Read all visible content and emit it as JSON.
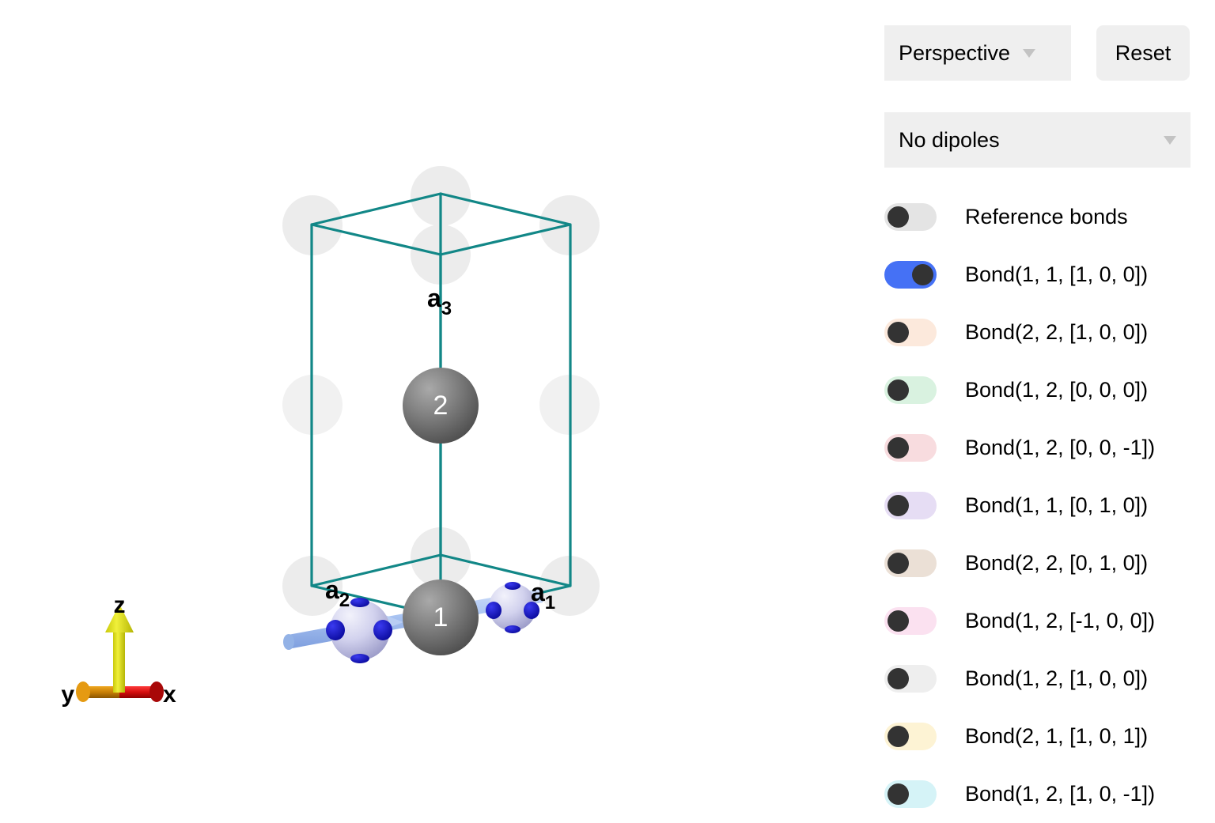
{
  "controls": {
    "projection": {
      "value": "Perspective",
      "caret_icon": "chevron-down-icon"
    },
    "reset": {
      "label": "Reset"
    },
    "dipoles": {
      "value": "No dipoles",
      "caret_icon": "chevron-down-icon"
    }
  },
  "legend": {
    "items": [
      {
        "label": "Reference bonds",
        "on": false,
        "color": "#e4e4e4"
      },
      {
        "label": "Bond(1, 1, [1, 0, 0])",
        "on": true,
        "color": "#4571f5"
      },
      {
        "label": "Bond(2, 2, [1, 0, 0])",
        "on": false,
        "color": "#fce9dc"
      },
      {
        "label": "Bond(1, 2, [0, 0, 0])",
        "on": false,
        "color": "#d9f2e0"
      },
      {
        "label": "Bond(1, 2, [0, 0, -1])",
        "on": false,
        "color": "#f8dcdf"
      },
      {
        "label": "Bond(1, 1, [0, 1, 0])",
        "on": false,
        "color": "#e6ddf4"
      },
      {
        "label": "Bond(2, 2, [0, 1, 0])",
        "on": false,
        "color": "#ebe0d6"
      },
      {
        "label": "Bond(1, 2, [-1, 0, 0])",
        "on": false,
        "color": "#fbe1f0"
      },
      {
        "label": "Bond(1, 2, [1, 0, 0])",
        "on": false,
        "color": "#eeeeee"
      },
      {
        "label": "Bond(2, 1, [1, 0, 1])",
        "on": false,
        "color": "#fdf3d4"
      },
      {
        "label": "Bond(1, 2, [1, 0, -1])",
        "on": false,
        "color": "#d5f3f7"
      }
    ]
  },
  "scene": {
    "cell_color": "#128787",
    "lattice_labels": {
      "a1": {
        "base": "a",
        "sub": "1"
      },
      "a2": {
        "base": "a",
        "sub": "2"
      },
      "a3": {
        "base": "a",
        "sub": "3"
      }
    },
    "atoms": [
      {
        "label": "1",
        "kind": "gray-sphere"
      },
      {
        "label": "2",
        "kind": "gray-sphere"
      }
    ],
    "bond_arrow_color": "#a8c4f0",
    "axes": {
      "x": {
        "label": "x",
        "color": "#d40d0d"
      },
      "y": {
        "label": "y",
        "color": "#cc8b00"
      },
      "z": {
        "label": "z",
        "color": "#e8e815"
      }
    }
  }
}
